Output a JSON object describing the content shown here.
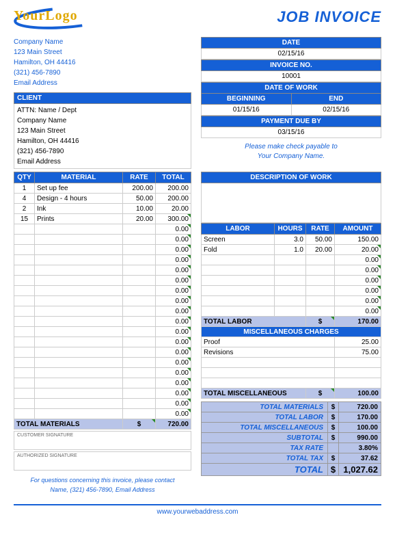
{
  "logo": {
    "text": "YourLogo"
  },
  "title": "JOB INVOICE",
  "company": {
    "name": "Company Name",
    "street": "123 Main Street",
    "city": "Hamilton, OH  44416",
    "phone": "(321) 456-7890",
    "email": "Email Address"
  },
  "client": {
    "header": "CLIENT",
    "attn": "ATTN: Name / Dept",
    "name": "Company Name",
    "street": "123 Main Street",
    "city": "Hamilton, OH  44416",
    "phone": "(321) 456-7890",
    "email": "Email Address"
  },
  "info": {
    "date_label": "DATE",
    "date": "02/15/16",
    "invoice_label": "INVOICE NO.",
    "invoice": "10001",
    "dow_label": "DATE OF WORK",
    "begin_label": "BEGINNING",
    "begin": "01/15/16",
    "end_label": "END",
    "end": "02/15/16",
    "due_label": "PAYMENT DUE BY",
    "due": "03/15/16"
  },
  "payable": {
    "line1": "Please make check payable to",
    "line2": "Your Company Name."
  },
  "materials": {
    "h_qty": "QTY",
    "h_mat": "MATERIAL",
    "h_rate": "RATE",
    "h_total": "TOTAL",
    "rows": [
      {
        "qty": "1",
        "mat": "Set up fee",
        "rate": "200.00",
        "total": "200.00"
      },
      {
        "qty": "4",
        "mat": "Design - 4 hours",
        "rate": "50.00",
        "total": "200.00"
      },
      {
        "qty": "2",
        "mat": "Ink",
        "rate": "10.00",
        "total": "20.00"
      },
      {
        "qty": "15",
        "mat": "Prints",
        "rate": "20.00",
        "total": "300.00"
      }
    ],
    "total_label": "TOTAL MATERIALS",
    "total_cur": "$",
    "total": "720.00"
  },
  "description": {
    "header": "DESCRIPTION OF WORK"
  },
  "labor": {
    "h_lab": "LABOR",
    "h_hrs": "HOURS",
    "h_rate": "RATE",
    "h_amt": "AMOUNT",
    "rows": [
      {
        "lab": "Screen",
        "hrs": "3.0",
        "rate": "50.00",
        "amt": "150.00"
      },
      {
        "lab": "Fold",
        "hrs": "1.0",
        "rate": "20.00",
        "amt": "20.00"
      }
    ],
    "total_label": "TOTAL LABOR",
    "total_cur": "$",
    "total": "170.00"
  },
  "misc": {
    "header": "MISCELLANEOUS CHARGES",
    "rows": [
      {
        "item": "Proof",
        "amt": "25.00"
      },
      {
        "item": "Revisions",
        "amt": "75.00"
      }
    ],
    "total_label": "TOTAL MISCELLANEOUS",
    "total_cur": "$",
    "total": "100.00"
  },
  "summary": {
    "mat_label": "TOTAL MATERIALS",
    "mat": "720.00",
    "lab_label": "TOTAL LABOR",
    "lab": "170.00",
    "misc_label": "TOTAL MISCELLANEOUS",
    "misc": "100.00",
    "sub_label": "SUBTOTAL",
    "sub": "990.00",
    "taxrate_label": "TAX RATE",
    "taxrate": "3.80%",
    "tax_label": "TOTAL TAX",
    "tax": "37.62",
    "total_label": "TOTAL",
    "total": "1,027.62",
    "cur": "$"
  },
  "sig": {
    "customer": "CUSTOMER SIGNATURE",
    "authorized": "AUTHORIZED SIGNATURE"
  },
  "questions": {
    "line1": "For questions concerning this invoice, please contact",
    "line2": "Name, (321) 456-7890, Email Address"
  },
  "footer": "www.yourwebaddress.com"
}
